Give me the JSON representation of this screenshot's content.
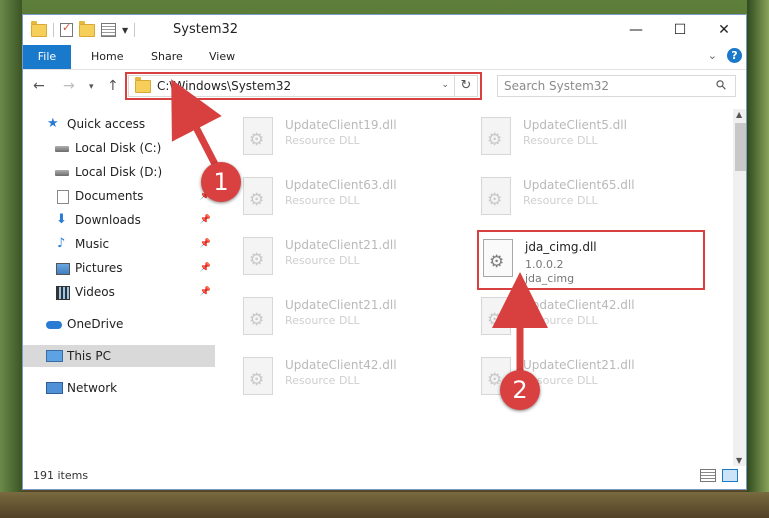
{
  "window": {
    "title": "System32",
    "controls": {
      "minimize": "—",
      "maximize": "☐",
      "close": "✕"
    }
  },
  "ribbon": {
    "tabs": [
      "File",
      "Home",
      "Share",
      "View"
    ]
  },
  "navigation": {
    "address": "C:\\Windows\\System32",
    "search_placeholder": "Search System32"
  },
  "sidebar": {
    "items": [
      {
        "label": "Quick access",
        "icon": "star-icon"
      },
      {
        "label": "Local Disk (C:)",
        "icon": "drive-icon"
      },
      {
        "label": "Local Disk (D:)",
        "icon": "drive-icon"
      },
      {
        "label": "Documents",
        "icon": "documents-icon",
        "pinned": true
      },
      {
        "label": "Downloads",
        "icon": "download-icon",
        "pinned": true
      },
      {
        "label": "Music",
        "icon": "music-icon",
        "pinned": true
      },
      {
        "label": "Pictures",
        "icon": "pictures-icon",
        "pinned": true
      },
      {
        "label": "Videos",
        "icon": "videos-icon",
        "pinned": true
      },
      {
        "label": "OneDrive",
        "icon": "cloud-icon"
      },
      {
        "label": "This PC",
        "icon": "computer-icon",
        "selected": true
      },
      {
        "label": "Network",
        "icon": "network-icon"
      }
    ]
  },
  "files": [
    {
      "name": "UpdateClient19.dll",
      "type": "Resource DLL"
    },
    {
      "name": "UpdateClient5.dll",
      "type": "Resource DLL"
    },
    {
      "name": "UpdateClient63.dll",
      "type": "Resource DLL"
    },
    {
      "name": "UpdateClient65.dll",
      "type": "Resource DLL"
    },
    {
      "name": "UpdateClient21.dll",
      "type": "Resource DLL"
    },
    {
      "name": "jda_cimg.dll",
      "type": "1.0.0.2",
      "company": "jda_cimg"
    },
    {
      "name": "UpdateClient21.dll",
      "type": "Resource DLL"
    },
    {
      "name": "UpdateClient42.dll",
      "type": "Resource DLL"
    },
    {
      "name": "UpdateClient42.dll",
      "type": "Resource DLL"
    },
    {
      "name": "UpdateClient21.dll",
      "type": "Resource DLL"
    }
  ],
  "status": {
    "item_count": "191 items"
  },
  "annotations": {
    "step1": "1",
    "step2": "2",
    "color": "#d8403f"
  }
}
